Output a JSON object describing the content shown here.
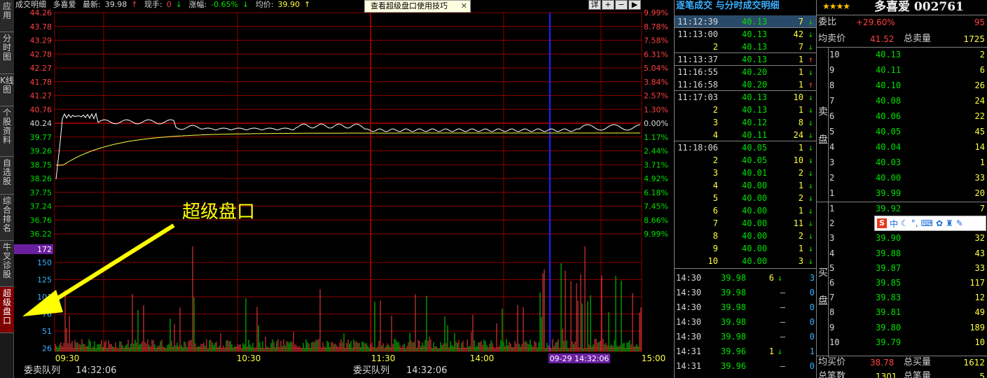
{
  "left_tabs": [
    {
      "label": "应用"
    },
    {
      "label": "分时图"
    },
    {
      "label": "K线图"
    },
    {
      "label": "个股资料"
    },
    {
      "label": "自选股"
    },
    {
      "label": "综合排名"
    },
    {
      "label": "牛叉诊股"
    },
    {
      "label": "超级盘口",
      "active": true
    }
  ],
  "header": {
    "section": "成交明细",
    "stock": "多喜爱",
    "latest_label": "最新:",
    "latest": "39.98",
    "hand_label": "现手:",
    "hand": "0",
    "change_label": "涨幅:",
    "change": "-0.65%",
    "avg_label": "均价:",
    "avg": "39.90",
    "tip": "查看超级盘口使用技巧",
    "tip_close": "✕",
    "toolbar": [
      "详",
      "+",
      "−",
      "▶"
    ]
  },
  "price_axis": {
    "left": [
      "44.26",
      "43.78",
      "43.29",
      "42.78",
      "42.27",
      "41.78",
      "41.27",
      "40.76",
      "40.24",
      "39.77",
      "39.26",
      "38.75",
      "38.26",
      "37.75",
      "37.24",
      "36.76",
      "36.22"
    ],
    "right": [
      "9.99%",
      "8.78%",
      "7.58%",
      "6.31%",
      "5.04%",
      "3.84%",
      "2.57%",
      "1.30%",
      "0.00%",
      "1.17%",
      "2.44%",
      "3.71%",
      "4.92%",
      "6.18%",
      "7.45%",
      "8.66%",
      "9.99%"
    ]
  },
  "volume_axis": {
    "highlight": "172",
    "ticks": [
      "150",
      "125",
      "101",
      "76",
      "51",
      "26"
    ]
  },
  "time_axis": [
    "09:30",
    "10:30",
    "11:30",
    "14:00",
    "15:00"
  ],
  "cursor_label": "09-29 14:32:06",
  "annotation": "超级盘口",
  "bottom": {
    "left_label": "委卖队列",
    "left_time": "14:32:06",
    "right_label": "委买队列",
    "right_time": "14:32:06"
  },
  "trade_panel": {
    "title": "逐笔成交 与分时成交明细",
    "rows": [
      {
        "t": "11:12:39",
        "p": "40.13",
        "v": "7",
        "a": "down"
      },
      {
        "t": "11:13:00",
        "p": "40.13",
        "v": "42",
        "a": "down"
      },
      {
        "t": "2",
        "p": "40.13",
        "v": "7",
        "a": "down"
      },
      {
        "t": "11:13:37",
        "p": "40.13",
        "v": "1",
        "a": "up"
      },
      {
        "t": "11:16:55",
        "p": "40.20",
        "v": "1",
        "a": "down"
      },
      {
        "t": "11:16:58",
        "p": "40.20",
        "v": "1",
        "a": "up"
      },
      {
        "t": "11:17:03",
        "p": "40.13",
        "v": "10",
        "a": "down"
      },
      {
        "t": "2",
        "p": "40.13",
        "v": "1",
        "a": "down"
      },
      {
        "t": "3",
        "p": "40.12",
        "v": "8",
        "a": "down"
      },
      {
        "t": "4",
        "p": "40.11",
        "v": "24",
        "a": "down"
      },
      {
        "t": "11:18:06",
        "p": "40.05",
        "v": "1",
        "a": "down"
      },
      {
        "t": "2",
        "p": "40.05",
        "v": "10",
        "a": "down"
      },
      {
        "t": "3",
        "p": "40.01",
        "v": "2",
        "a": "down"
      },
      {
        "t": "4",
        "p": "40.00",
        "v": "1",
        "a": "down"
      },
      {
        "t": "5",
        "p": "40.00",
        "v": "2",
        "a": "down"
      },
      {
        "t": "6",
        "p": "40.00",
        "v": "1",
        "a": "down"
      },
      {
        "t": "7",
        "p": "40.00",
        "v": "11",
        "a": "down"
      },
      {
        "t": "8",
        "p": "40.00",
        "v": "2",
        "a": "down"
      },
      {
        "t": "9",
        "p": "40.00",
        "v": "1",
        "a": "down"
      },
      {
        "t": "10",
        "p": "40.00",
        "v": "3",
        "a": "down"
      }
    ],
    "minute_rows": [
      {
        "t": "14:30",
        "p": "39.98",
        "v": "6",
        "a": "down",
        "n": "3"
      },
      {
        "t": "14:30",
        "p": "39.98",
        "v": "",
        "a": "dash",
        "n": "0"
      },
      {
        "t": "14:30",
        "p": "39.98",
        "v": "",
        "a": "dash",
        "n": "0"
      },
      {
        "t": "14:30",
        "p": "39.98",
        "v": "",
        "a": "dash",
        "n": "0"
      },
      {
        "t": "14:30",
        "p": "39.98",
        "v": "",
        "a": "dash",
        "n": "0"
      },
      {
        "t": "14:31",
        "p": "39.96",
        "v": "1",
        "a": "down",
        "n": "1"
      },
      {
        "t": "14:31",
        "p": "39.96",
        "v": "",
        "a": "dash",
        "n": "0"
      }
    ]
  },
  "quote_panel": {
    "stars": "★★★★",
    "name": "多喜爱 002761",
    "webi_label": "委比",
    "webi": "+29.60%",
    "webi_diff": "95",
    "avg_sell_label": "均卖价",
    "avg_sell": "41.52",
    "total_sell_label": "总卖量",
    "total_sell": "1725",
    "sell_side_label": "卖盘",
    "sell_book": [
      {
        "lv": "10",
        "p": "40.13",
        "v": "2"
      },
      {
        "lv": "9",
        "p": "40.11",
        "v": "6"
      },
      {
        "lv": "8",
        "p": "40.10",
        "v": "26"
      },
      {
        "lv": "7",
        "p": "40.08",
        "v": "24"
      },
      {
        "lv": "6",
        "p": "40.06",
        "v": "22"
      },
      {
        "lv": "5",
        "p": "40.05",
        "v": "45"
      },
      {
        "lv": "4",
        "p": "40.04",
        "v": "14"
      },
      {
        "lv": "3",
        "p": "40.03",
        "v": "1"
      },
      {
        "lv": "2",
        "p": "40.00",
        "v": "33"
      },
      {
        "lv": "1",
        "p": "39.99",
        "v": "20"
      }
    ],
    "buy_side_label": "买盘",
    "buy_book": [
      {
        "lv": "1",
        "p": "39.92",
        "v": "7"
      },
      {
        "lv": "2",
        "p": "",
        "v": ""
      },
      {
        "lv": "3",
        "p": "39.90",
        "v": "32"
      },
      {
        "lv": "4",
        "p": "39.88",
        "v": "43"
      },
      {
        "lv": "5",
        "p": "39.87",
        "v": "33"
      },
      {
        "lv": "6",
        "p": "39.85",
        "v": "117"
      },
      {
        "lv": "7",
        "p": "39.83",
        "v": "12"
      },
      {
        "lv": "8",
        "p": "39.81",
        "v": "49"
      },
      {
        "lv": "9",
        "p": "39.80",
        "v": "189"
      },
      {
        "lv": "10",
        "p": "39.79",
        "v": "10"
      }
    ],
    "avg_buy_label": "均买价",
    "avg_buy": "38.78",
    "total_buy_label": "总买量",
    "total_buy": "1612",
    "total_count_label": "总笔数",
    "total_count": "1301",
    "total_count_label2": "总笔量",
    "total_count2": "5"
  },
  "ime": {
    "logo": "S",
    "lang": "中"
  },
  "colors": {
    "up": "#ff4040",
    "down": "#00e000",
    "grid": "#8b0000",
    "avg_line": "#ffff40",
    "price_line": "#ffffff",
    "cursor": "#2020ff"
  }
}
